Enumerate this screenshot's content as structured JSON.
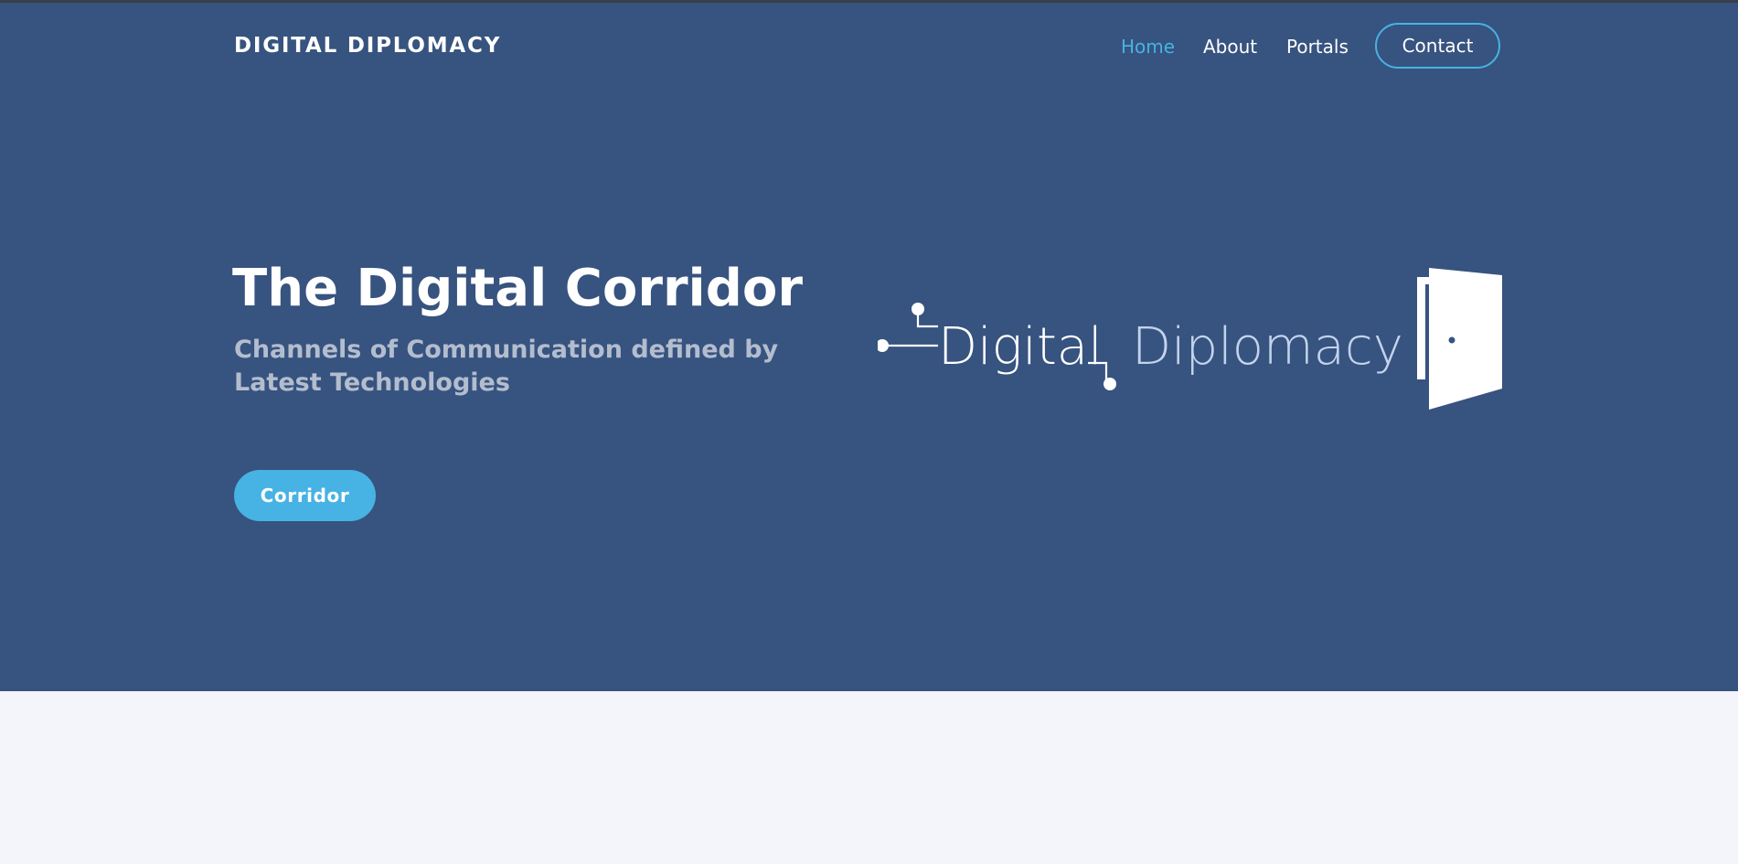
{
  "header": {
    "brand": "DIGITAL DIPLOMACY",
    "nav": [
      {
        "label": "Home",
        "active": true
      },
      {
        "label": "About"
      },
      {
        "label": "Portals"
      }
    ],
    "contact_label": "Contact"
  },
  "hero": {
    "title": "The Digital Corridor",
    "subtitle": "Channels of Communication defined by Latest Technologies",
    "cta_label": "Corridor"
  },
  "logo": {
    "word1": "Digital",
    "word2": "Diplomacy",
    "icons": [
      "circuit-icon",
      "door-icon"
    ]
  },
  "colors": {
    "hero_bg": "#37537f",
    "accent": "#47b2e4",
    "page_bg": "#f3f5fa",
    "logo_light": "#c3d3ec"
  }
}
